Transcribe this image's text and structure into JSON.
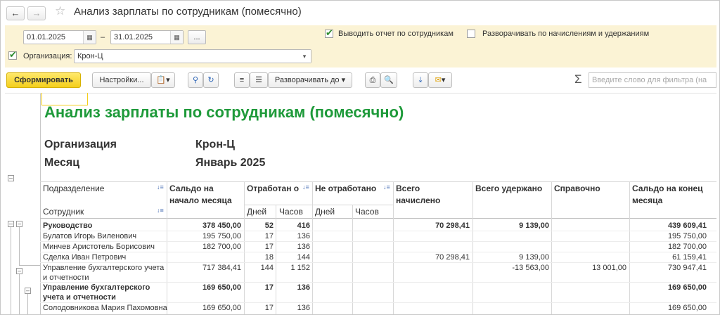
{
  "window": {
    "title": "Анализ зарплаты по сотрудникам (помесячно)",
    "back_icon": "arrow-left-icon",
    "forward_icon": "arrow-right-icon",
    "favorite_icon": "star-icon"
  },
  "params": {
    "date_from": "01.01.2025",
    "date_to": "31.01.2025",
    "dash": "–",
    "period_button": "...",
    "by_employees_label": "Выводить отчет по сотрудникам",
    "by_employees_checked": true,
    "expand_label": "Разворачивать по начислениям и удержаниям",
    "expand_checked": false,
    "org_label": "Организация:",
    "org_checked": true,
    "org_value": "Крон-Ц"
  },
  "toolbar": {
    "generate": "Сформировать",
    "settings": "Настройки...",
    "expand_to": "Разворачивать до",
    "filter_placeholder": "Введите слово для фильтра (на",
    "sigma": "Σ"
  },
  "report": {
    "title": "Анализ зарплаты по сотрудникам (помесячно)",
    "org_caption": "Организация",
    "org_value": "Крон-Ц",
    "month_caption": "Месяц",
    "month_value": "Январь 2025",
    "columns": {
      "department": "Подразделение",
      "employee": "Сотрудник",
      "opening": "Сальдо на начало месяца",
      "worked": "Отработан о",
      "not_worked": "Не отработано",
      "days": "Дней",
      "hours": "Часов",
      "accrued": "Всего начислено",
      "withheld": "Всего удержано",
      "reference": "Справочно",
      "closing": "Сальдо на конец месяца"
    },
    "rows": [
      {
        "name": "Руководство",
        "opening": "378 450,00",
        "days": "52",
        "hours": "416",
        "accrued": "70 298,41",
        "withheld": "9 139,00",
        "reference": "",
        "closing": "439 609,41",
        "bold": true
      },
      {
        "name": "Булатов Игорь Виленович",
        "opening": "195 750,00",
        "days": "17",
        "hours": "136",
        "accrued": "",
        "withheld": "",
        "reference": "",
        "closing": "195 750,00"
      },
      {
        "name": "Минчев Аристотель Борисович",
        "opening": "182 700,00",
        "days": "17",
        "hours": "136",
        "accrued": "",
        "withheld": "",
        "reference": "",
        "closing": "182 700,00"
      },
      {
        "name": "Сделка Иван Петрович",
        "opening": "",
        "days": "18",
        "hours": "144",
        "accrued": "70 298,41",
        "withheld": "9 139,00",
        "reference": "",
        "closing": "61 159,41"
      },
      {
        "name": "Управление бухгалтерского учета и отчетности",
        "opening": "717 384,41",
        "days": "144",
        "hours": "1 152",
        "accrued": "",
        "withheld": "-13 563,00",
        "reference": "13 001,00",
        "closing": "730 947,41"
      },
      {
        "name": "Управление бухгалтерского учета и отчетности",
        "opening": "169 650,00",
        "days": "17",
        "hours": "136",
        "accrued": "",
        "withheld": "",
        "reference": "",
        "closing": "169 650,00",
        "bold": true
      },
      {
        "name": "Солодовникова Мария Пахомовна",
        "opening": "169 650,00",
        "days": "17",
        "hours": "136",
        "accrued": "",
        "withheld": "",
        "reference": "",
        "closing": "169 650,00"
      }
    ]
  },
  "colors": {
    "accent_yellow": "#f4cf1c",
    "title_green": "#1e9a3a",
    "params_bg": "#fbf3d5"
  }
}
